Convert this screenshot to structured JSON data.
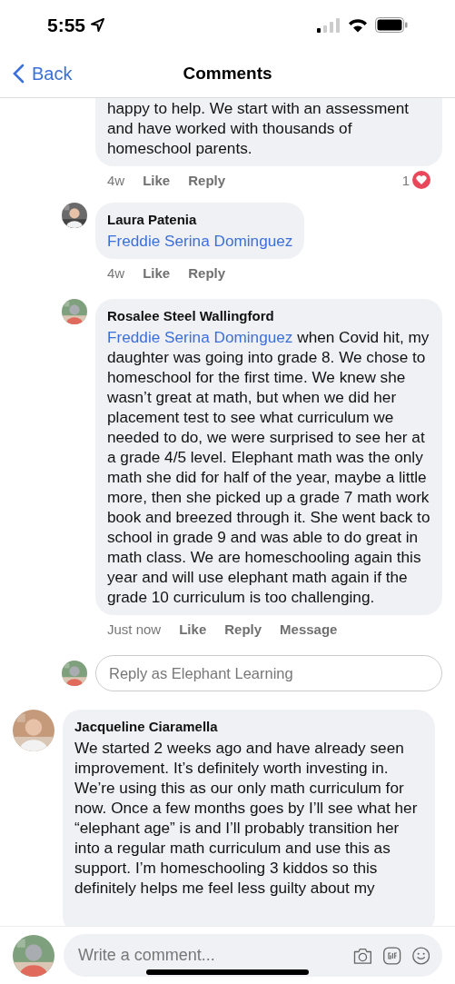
{
  "status_bar": {
    "time": "5:55"
  },
  "nav": {
    "back": "Back",
    "title": "Comments"
  },
  "replies": [
    {
      "text": "happy to help. We start with an assessment and have worked with thousands of homeschool parents.",
      "time": "4w",
      "actions": [
        "Like",
        "Reply"
      ],
      "reaction_count": "1"
    },
    {
      "author": "Laura Patenia",
      "mention": "Freddie Serina Dominguez",
      "time": "4w",
      "actions": [
        "Like",
        "Reply"
      ]
    },
    {
      "author": "Rosalee Steel Wallingford",
      "mention": "Freddie Serina Dominguez",
      "text": "when Covid hit, my daughter was going into grade 8. We chose to homeschool for the first time. We knew she wasn’t great at math, but when we did her placement test to see what curriculum we needed to do, we were surprised to see her at a grade 4/5 level. Elephant math was the only math she did for half of the year, maybe a little more, then she picked up a grade 7 math work book and breezed through it.  She went back to school in grade 9 and was able to do great in math class. We are homeschooling again this year and will use elephant math again if the grade 10 curriculum is too challenging.",
      "time": "Just now",
      "actions": [
        "Like",
        "Reply",
        "Message"
      ]
    }
  ],
  "reply_box": {
    "placeholder": "Reply as Elephant Learning"
  },
  "comments": [
    {
      "author": "Jacqueline Ciaramella",
      "text": "We started 2 weeks ago and have already seen improvement. It’s definitely worth investing in. We’re using this as our only math curriculum for now. Once a few months goes by I’ll see what her “elephant age” is and I’ll probably transition her into a regular math curriculum and use this as support. I’m homeschooling 3 kiddos so this definitely helps me feel less guilty about my"
    }
  ],
  "composer": {
    "placeholder": "Write a comment..."
  }
}
